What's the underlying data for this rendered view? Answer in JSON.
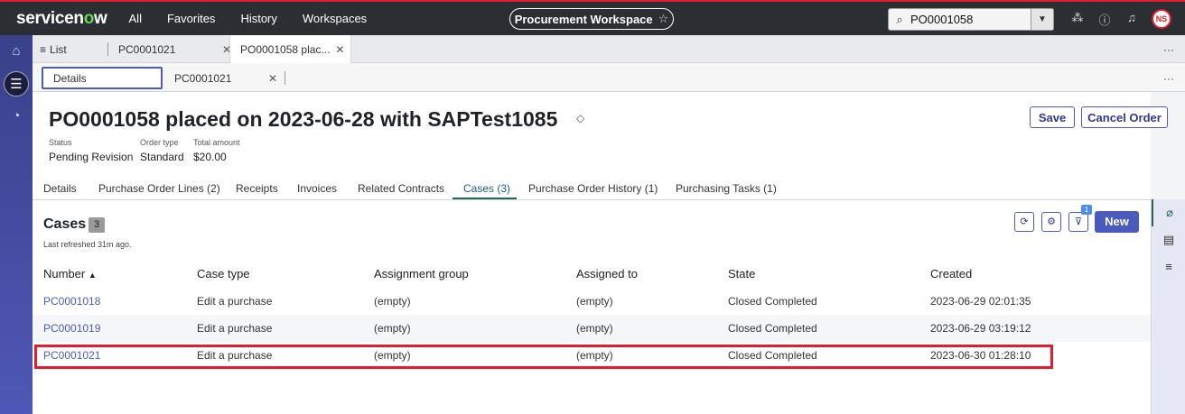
{
  "app": {
    "logo_left": "servicen",
    "logo_o": "o",
    "logo_right": "w",
    "nav": [
      "All",
      "Favorites",
      "History",
      "Workspaces"
    ],
    "workspace": "Procurement Workspace",
    "search_value": "PO0001058",
    "avatar_initials": "NS"
  },
  "tabs_primary": [
    {
      "label": "List"
    },
    {
      "label": "PC0001021"
    },
    {
      "label": "PO0001058 plac..."
    }
  ],
  "tabs_secondary": [
    {
      "label": "Details"
    },
    {
      "label": "PC0001021"
    }
  ],
  "record": {
    "title": "PO0001058 placed on 2023-06-28 with SAPTest1085",
    "save_label": "Save",
    "cancel_label": "Cancel Order",
    "meta": [
      {
        "label": "Status",
        "value": "Pending Revision"
      },
      {
        "label": "Order type",
        "value": "Standard"
      },
      {
        "label": "Total amount",
        "value": "$20.00"
      }
    ]
  },
  "section_tabs": [
    "Details",
    "Purchase Order Lines (2)",
    "Receipts",
    "Invoices",
    "Related Contracts",
    "Cases (3)",
    "Purchase Order History (1)",
    "Purchasing Tasks (1)"
  ],
  "cases": {
    "title": "Cases",
    "count": "3",
    "refreshed": "Last refreshed 31m ago.",
    "filter_badge": "1",
    "new_label": "New",
    "columns": [
      "Number",
      "Case type",
      "Assignment group",
      "Assigned to",
      "State",
      "Created"
    ],
    "rows": [
      [
        "PC0001018",
        "Edit a purchase",
        "(empty)",
        "(empty)",
        "Closed Completed",
        "2023-06-29 02:01:35"
      ],
      [
        "PC0001019",
        "Edit a purchase",
        "(empty)",
        "(empty)",
        "Closed Completed",
        "2023-06-29 03:19:12"
      ],
      [
        "PC0001021",
        "Edit a purchase",
        "(empty)",
        "(empty)",
        "Closed Completed",
        "2023-06-30 01:28:10"
      ]
    ]
  },
  "colors": {
    "brand_red": "#e01e2c",
    "accent": "#4a5bbb",
    "topbar": "#2b2f34"
  }
}
